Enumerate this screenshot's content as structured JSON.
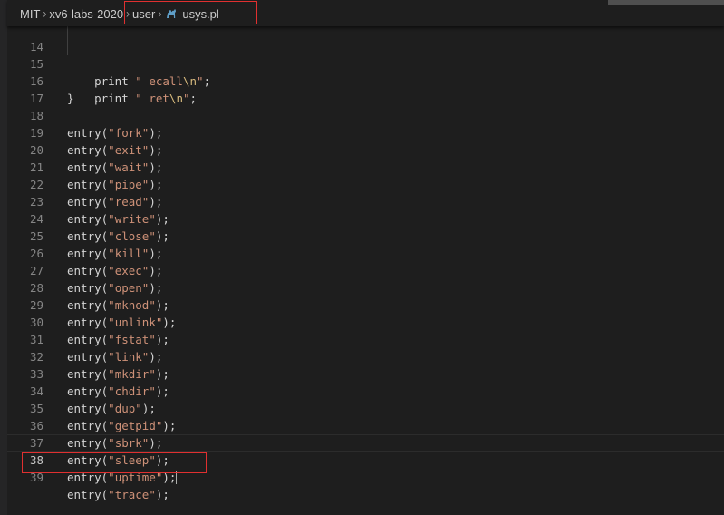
{
  "breadcrumb": {
    "items": [
      "MIT",
      "xv6-labs-2020",
      "user"
    ],
    "file": "usys.pl",
    "file_icon": "perl-camel-icon"
  },
  "editor": {
    "lines": [
      {
        "number": "14",
        "indent": "    ",
        "keyword": "print",
        "string": "\" ecall\\n\"",
        "suffix": ";"
      },
      {
        "number": "15",
        "indent": "    ",
        "keyword": "print",
        "string": "\" ret\\n\"",
        "suffix": ";"
      },
      {
        "number": "16",
        "text": "}"
      },
      {
        "number": "17",
        "text": ""
      },
      {
        "number": "18",
        "func": "entry",
        "arg": "\"fork\""
      },
      {
        "number": "19",
        "func": "entry",
        "arg": "\"exit\""
      },
      {
        "number": "20",
        "func": "entry",
        "arg": "\"wait\""
      },
      {
        "number": "21",
        "func": "entry",
        "arg": "\"pipe\""
      },
      {
        "number": "22",
        "func": "entry",
        "arg": "\"read\""
      },
      {
        "number": "23",
        "func": "entry",
        "arg": "\"write\""
      },
      {
        "number": "24",
        "func": "entry",
        "arg": "\"close\""
      },
      {
        "number": "25",
        "func": "entry",
        "arg": "\"kill\""
      },
      {
        "number": "26",
        "func": "entry",
        "arg": "\"exec\""
      },
      {
        "number": "27",
        "func": "entry",
        "arg": "\"open\""
      },
      {
        "number": "28",
        "func": "entry",
        "arg": "\"mknod\""
      },
      {
        "number": "29",
        "func": "entry",
        "arg": "\"unlink\""
      },
      {
        "number": "30",
        "func": "entry",
        "arg": "\"fstat\""
      },
      {
        "number": "31",
        "func": "entry",
        "arg": "\"link\""
      },
      {
        "number": "32",
        "func": "entry",
        "arg": "\"mkdir\""
      },
      {
        "number": "33",
        "func": "entry",
        "arg": "\"chdir\""
      },
      {
        "number": "34",
        "func": "entry",
        "arg": "\"dup\""
      },
      {
        "number": "35",
        "func": "entry",
        "arg": "\"getpid\""
      },
      {
        "number": "36",
        "func": "entry",
        "arg": "\"sbrk\""
      },
      {
        "number": "37",
        "func": "entry",
        "arg": "\"sleep\""
      },
      {
        "number": "38",
        "func": "entry",
        "arg": "\"uptime\"",
        "current": true
      },
      {
        "number": "39",
        "func": "entry",
        "arg": "\"trace\""
      }
    ]
  },
  "colors": {
    "background": "#1e1e1e",
    "string": "#ce9178",
    "escape": "#d7ba7d",
    "text": "#d4d4d4",
    "line_number": "#858585",
    "highlight_box": "#e03030"
  }
}
